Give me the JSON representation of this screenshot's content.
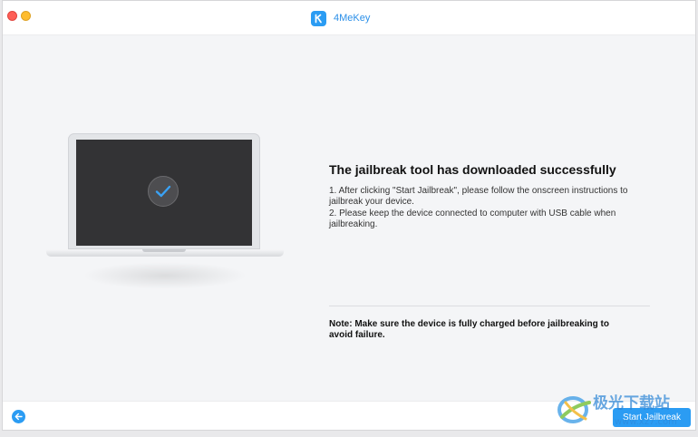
{
  "window": {
    "title": "4MeKey",
    "logo_letter": "K"
  },
  "main": {
    "heading": "The jailbreak tool has downloaded successfully",
    "instructions": [
      "1. After clicking \"Start Jailbreak\", please follow the onscreen instructions to jailbreak your device.",
      "2. Please keep the device connected to computer with USB cable when jailbreaking."
    ],
    "note": "Note: Make sure the device is fully charged before jailbreaking to avoid failure."
  },
  "footer": {
    "start_label": "Start Jailbreak"
  },
  "watermark": {
    "text_cn": "极光下载站",
    "text_url": "www.xz7.com"
  },
  "colors": {
    "accent": "#2b9cf3",
    "background": "#f4f5f7",
    "screen": "#333335"
  },
  "icons": {
    "back": "arrow-left-icon",
    "success": "checkmark-icon",
    "logo": "k-logo-icon"
  }
}
